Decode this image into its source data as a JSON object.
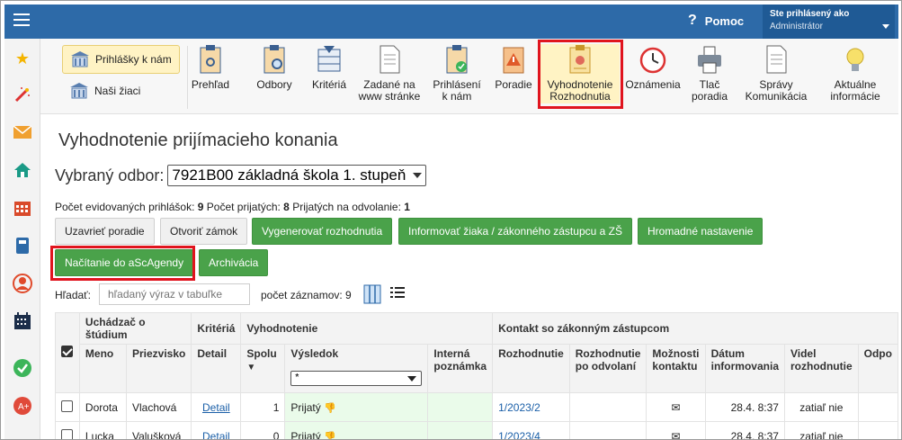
{
  "topbar": {
    "help_label": "Pomoc",
    "user_line1": "Ste prihlásený ako",
    "user_line2": "Administrátor"
  },
  "toolbar": {
    "left_buttons": [
      "Prihlášky k nám",
      "Naši žiaci"
    ],
    "tools": [
      {
        "l1": "Prehľad",
        "l2": ""
      },
      {
        "l1": "Odbory",
        "l2": ""
      },
      {
        "l1": "Kritériá",
        "l2": ""
      },
      {
        "l1": "Zadané na",
        "l2": "www stránke"
      },
      {
        "l1": "Prihlásení",
        "l2": "k nám"
      },
      {
        "l1": "Poradie",
        "l2": ""
      },
      {
        "l1": "Vyhodnotenie",
        "l2": "Rozhodnutia"
      },
      {
        "l1": "Oznámenia",
        "l2": ""
      },
      {
        "l1": "Tlač",
        "l2": "poradia"
      },
      {
        "l1": "Správy",
        "l2": "Komunikácia"
      },
      {
        "l1": "Aktuálne",
        "l2": "informácie"
      }
    ],
    "highlight_color": "#e0141e"
  },
  "page": {
    "title": "Vyhodnotenie prijímacieho konania",
    "odbor_label": "Vybraný odbor:",
    "odbor_value": "7921B00 základná škola 1. stupeň",
    "stats_prefix1": "Počet evidovaných prihlášok: ",
    "stats_val1": "9",
    "stats_prefix2": " Počet prijatých: ",
    "stats_val2": "8",
    "stats_prefix3": " Prijatých na odvolanie: ",
    "stats_val3": "1"
  },
  "actions": {
    "close_order": "Uzavrieť poradie",
    "open_lock": "Otvoriť zámok",
    "generate": "Vygenerovať rozhodnutia",
    "inform": "Informovať žiaka / zákonného zástupcu a ZŠ",
    "bulk": "Hromadné nastavenie",
    "import": "Načítanie do aScAgendy",
    "archive": "Archivácia",
    "accent_green": "#4aa24a"
  },
  "search": {
    "label": "Hľadať:",
    "placeholder": "hľadaný výraz v tabuľke",
    "count_label": "počet záznamov: 9"
  },
  "table": {
    "group_headers": {
      "student": "Uchádzač o štúdium",
      "criteria": "Kritériá",
      "eval": "Vyhodnotenie",
      "contact": "Kontakt so zákonným zástupcom"
    },
    "headers": {
      "meno": "Meno",
      "priezvisko": "Priezvisko",
      "detail": "Detail",
      "spolu": "Spolu",
      "vysledok": "Výsledok",
      "interna": "Interná poznámka",
      "rozhodnutie": "Rozhodnutie",
      "rozh_odv": "Rozhodnutie po odvolaní",
      "moznosti": "Možnosti kontaktu",
      "datum": "Dátum informovania",
      "videl": "Videl rozhodnutie",
      "odpo": "Odpo"
    },
    "filter_value": "*",
    "rows": [
      {
        "meno": "Dorota",
        "priezvisko": "Vlachová",
        "detail": "Detail",
        "spolu": "1",
        "vysledok": "Prijatý",
        "rozhodnutie": "1/2023/2",
        "datum": "28.4. 8:37",
        "videl": "zatiaľ nie"
      },
      {
        "meno": "Lucka",
        "priezvisko": "Valušková",
        "detail": "Detail",
        "spolu": "0",
        "vysledok": "Prijatý",
        "rozhodnutie": "1/2023/4",
        "datum": "28.4. 8:37",
        "videl": "zatiaľ nie"
      }
    ]
  }
}
